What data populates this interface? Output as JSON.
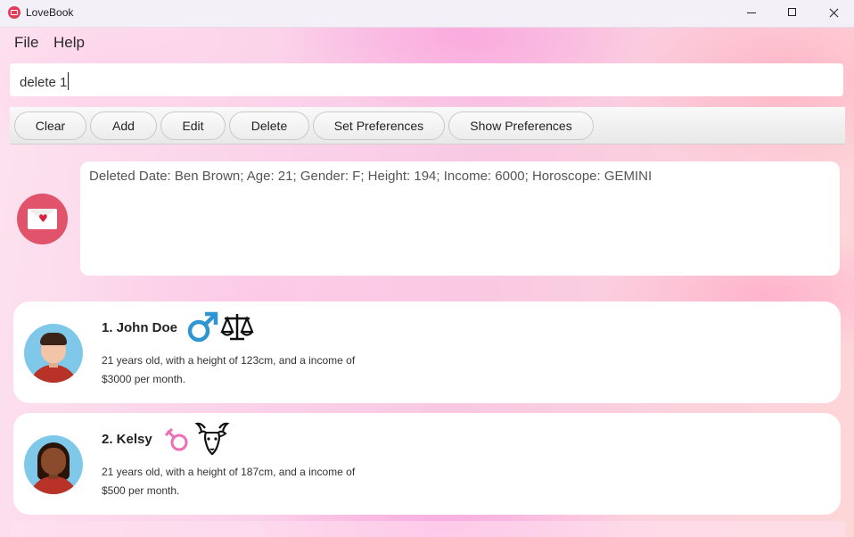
{
  "window": {
    "title": "LoveBook"
  },
  "menu": {
    "file": "File",
    "help": "Help"
  },
  "command": {
    "value": "delete 1"
  },
  "toolbar": {
    "clear": "Clear",
    "add": "Add",
    "edit": "Edit",
    "delete": "Delete",
    "set_preferences": "Set Preferences",
    "show_preferences": "Show Preferences"
  },
  "result": {
    "message": "Deleted Date: Ben Brown; Age: 21; Gender: F; Height: 194; Income: 6000; Horoscope: GEMINI"
  },
  "dates": [
    {
      "index_name": "1.  John Doe",
      "line1": "21 years old, with a height of 123cm, and a income of",
      "line2": "$3000 per month.",
      "gender_icon": "male-symbol-icon",
      "horoscope_icon": "libra-icon",
      "avatar_skin": "#f2c4a8",
      "avatar_hair": "#3b2417",
      "avatar_shirt": "#c0392b"
    },
    {
      "index_name": "2.  Kelsy",
      "line1": "21 years old, with a height of 187cm, and a income of",
      "line2": "$500 per month.",
      "gender_icon": "female-symbol-icon",
      "horoscope_icon": "capricorn-goat-icon",
      "avatar_skin": "#8a4b2c",
      "avatar_hair": "#2a1408",
      "avatar_shirt": "#c0392b"
    }
  ],
  "colors": {
    "male_symbol": "#2f95d3",
    "female_symbol": "#ee6eb5",
    "envelope_badge": "#e0536b",
    "app_icon": "#e23c5a"
  }
}
